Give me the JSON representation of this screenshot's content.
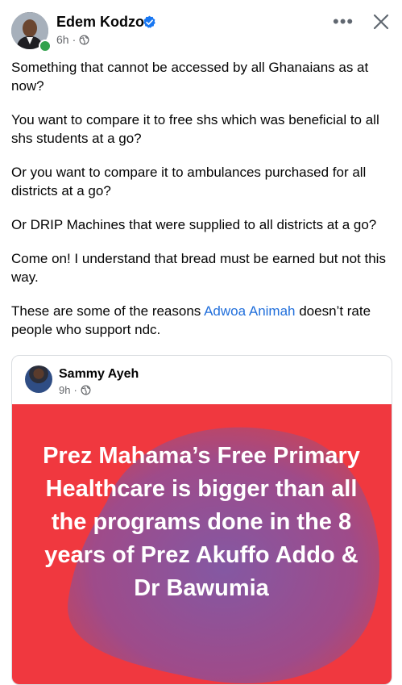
{
  "post": {
    "author": "Edem Kodzo",
    "time": "6h",
    "paragraphs": [
      "Something that cannot be accessed by all Ghanaians as at now?",
      "You want to compare it to free shs which was beneficial to all shs students at a go?",
      "Or you want to compare it to ambulances purchased for all districts at a go?",
      "Or DRIP Machines that were supplied to all districts at a go?",
      "Come on! I understand that bread must be earned but not this way."
    ],
    "last_before": "These are some of the reasons ",
    "mention": "Adwoa Animah",
    "last_after": " doesn’t rate people who support ndc.",
    "icons": {
      "verified": "verified-badge-icon",
      "privacy": "globe-icon",
      "more": "more-options-icon",
      "close": "close-icon"
    }
  },
  "shared": {
    "author": "Sammy Ayeh",
    "time": "9h",
    "banner_text": "Prez Mahama’s Free Primary Healthcare is bigger than all the programs done in the 8 years of Prez Akuffo Addo & Dr Bawumia",
    "colors": {
      "background": "#f0383f",
      "blob": "#8a57a5",
      "text": "#ffffff"
    }
  },
  "colors": {
    "link": "#216fdb",
    "verified": "#1877f2",
    "online": "#31a24c",
    "meta": "#65676b"
  }
}
